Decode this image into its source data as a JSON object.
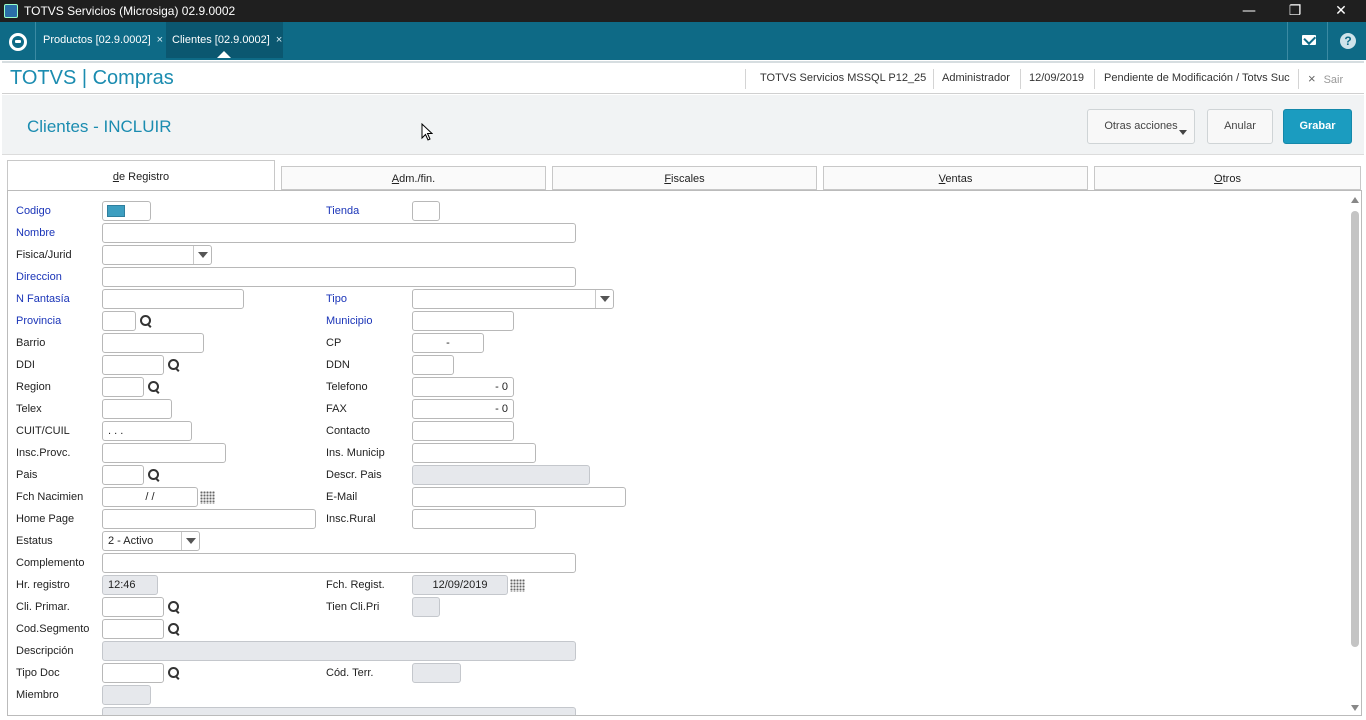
{
  "window": {
    "title": "TOTVS Servicios (Microsiga) 02.9.0002",
    "minimize": "—",
    "restore": "❐",
    "close": "✕"
  },
  "tabs": [
    {
      "label": "Productos [02.9.0002]",
      "close": "×"
    },
    {
      "label": "Clientes [02.9.0002]",
      "close": "×"
    }
  ],
  "header": {
    "brand": "TOTVS | Compras",
    "environment": "TOTVS Servicios MSSQL P12_25",
    "user": "Administrador",
    "date": "12/09/2019",
    "branch": "Pendiente de Modificación / Totvs Suc",
    "exit_label": "Sair",
    "exit_icon": "×"
  },
  "form": {
    "title": "Clientes - INCLUIR",
    "buttons": {
      "more": "Otras acciones",
      "cancel": "Anular",
      "save": "Grabar"
    }
  },
  "folders": [
    {
      "hot": "d",
      "rest": "e Registro"
    },
    {
      "hot": "A",
      "rest": "dm./fin."
    },
    {
      "hot": "F",
      "rest": "iscales"
    },
    {
      "hot": "V",
      "rest": "entas"
    },
    {
      "hot": "O",
      "rest": "tros"
    }
  ],
  "fields": {
    "codigo": {
      "label": "Codigo",
      "value": ""
    },
    "tienda": {
      "label": "Tienda",
      "value": ""
    },
    "nombre": {
      "label": "Nombre",
      "value": ""
    },
    "fisica": {
      "label": "Fisica/Jurid",
      "value": ""
    },
    "direccion": {
      "label": "Direccion",
      "value": ""
    },
    "fantasia": {
      "label": "N Fantasía",
      "value": ""
    },
    "tipo": {
      "label": "Tipo",
      "value": ""
    },
    "provincia": {
      "label": "Provincia",
      "value": ""
    },
    "municipio": {
      "label": "Municipio",
      "value": ""
    },
    "barrio": {
      "label": "Barrio",
      "value": ""
    },
    "cp": {
      "label": "CP",
      "value": "-"
    },
    "ddi": {
      "label": "DDI",
      "value": ""
    },
    "ddn": {
      "label": "DDN",
      "value": ""
    },
    "region": {
      "label": "Region",
      "value": ""
    },
    "telefono": {
      "label": "Telefono",
      "value": "-  0"
    },
    "telex": {
      "label": "Telex",
      "value": ""
    },
    "fax": {
      "label": "FAX",
      "value": "-  0"
    },
    "cuit": {
      "label": "CUIT/CUIL",
      "value": ".  .  ."
    },
    "contacto": {
      "label": "Contacto",
      "value": ""
    },
    "insc_provc": {
      "label": "Insc.Provc.",
      "value": ""
    },
    "ins_municip": {
      "label": "Ins. Municip",
      "value": ""
    },
    "pais": {
      "label": "Pais",
      "value": ""
    },
    "descr_pais": {
      "label": "Descr. Pais",
      "value": ""
    },
    "fch_nacimien": {
      "label": "Fch Nacimien",
      "value": "/  /"
    },
    "email": {
      "label": "E-Mail",
      "value": ""
    },
    "home_page": {
      "label": "Home Page",
      "value": ""
    },
    "insc_rural": {
      "label": "Insc.Rural",
      "value": ""
    },
    "estatus": {
      "label": "Estatus",
      "value": "2 - Activo"
    },
    "complemento": {
      "label": "Complemento",
      "value": ""
    },
    "hr_registro": {
      "label": "Hr. registro",
      "value": "12:46"
    },
    "fch_regist": {
      "label": "Fch. Regist.",
      "value": "12/09/2019"
    },
    "cli_primar": {
      "label": "Cli. Primar.",
      "value": ""
    },
    "tien_cli_pri": {
      "label": "Tien Cli.Pri",
      "value": ""
    },
    "cod_segmento": {
      "label": "Cod.Segmento",
      "value": ""
    },
    "descripcion": {
      "label": "Descripción",
      "value": ""
    },
    "tipo_doc": {
      "label": "Tipo Doc",
      "value": ""
    },
    "cod_terr": {
      "label": "Cód. Terr.",
      "value": ""
    },
    "miembro": {
      "label": "Miembro",
      "value": ""
    }
  }
}
